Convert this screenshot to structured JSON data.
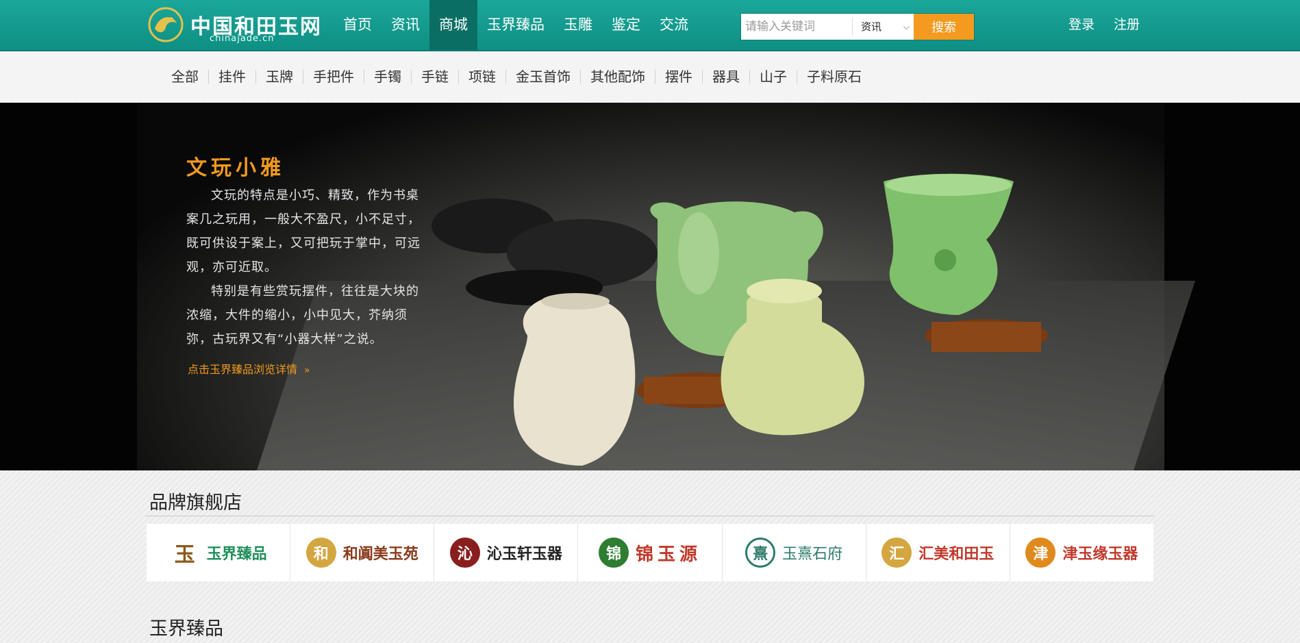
{
  "header": {
    "logo_text": "中国和田玉网",
    "logo_sub": "chinajade.cn",
    "nav": [
      {
        "label": "首页"
      },
      {
        "label": "资讯"
      },
      {
        "label": "商城",
        "active": true
      },
      {
        "label": "玉界臻品"
      },
      {
        "label": "玉雕"
      },
      {
        "label": "鉴定"
      },
      {
        "label": "交流"
      }
    ],
    "search": {
      "placeholder": "请输入关键词",
      "value": "",
      "category": "资讯",
      "button": "搜索"
    },
    "login": "登录",
    "register": "注册"
  },
  "categories": [
    "全部",
    "挂件",
    "玉牌",
    "手把件",
    "手镯",
    "手链",
    "项链",
    "金玉首饰",
    "其他配饰",
    "摆件",
    "器具",
    "山子",
    "子料原石"
  ],
  "banner": {
    "title": "文玩小雅",
    "paragraph1": "文玩的特点是小巧、精致，作为书桌案几之玩用，一般大不盈尺，小不足寸，既可供设于案上，又可把玩于掌中，可远观，亦可近取。",
    "paragraph2": "特别是有些赏玩摆件，往往是大块的浓缩，大件的缩小，小中见大，芥纳须弥，古玩界又有“小器大样”之说。",
    "link": "点击玉界臻品浏览详情"
  },
  "brand_section": {
    "title": "品牌旗舰店",
    "brands": [
      {
        "name": "玉界臻品",
        "icon_char": "玉",
        "color": "#1f8f5a",
        "icon_color": "#8a5a1a",
        "icon": "yujie-logo-icon"
      },
      {
        "name": "和阗美玉苑",
        "icon_char": "和",
        "color": "#8a3b1b",
        "icon_color": "#d4a640",
        "icon": "cloud-logo-icon"
      },
      {
        "name": "沁玉轩玉器",
        "icon_char": "沁",
        "color": "#222222",
        "icon_color": "#8a1e1e",
        "icon": "swirl-logo-icon"
      },
      {
        "name": "锦玉源",
        "icon_char": "锦",
        "color": "#c0392b",
        "icon_color": "#2e7d32",
        "icon": "yinyang-logo-icon"
      },
      {
        "name": "玉熹石府",
        "icon_char": "熹",
        "color": "#2c7a6b",
        "icon_color": "#2c7a6b",
        "icon": "circle-pattern-icon"
      },
      {
        "name": "汇美和田玉",
        "icon_char": "汇",
        "color": "#c0392b",
        "icon_color": "#d4a640",
        "icon": "dragon-logo-icon"
      },
      {
        "name": "津玉缘玉器",
        "icon_char": "津",
        "color": "#c0392b",
        "icon_color": "#e08a1e",
        "icon": "seal-logo-icon"
      }
    ]
  },
  "jade_section": {
    "title": "玉界臻品"
  }
}
